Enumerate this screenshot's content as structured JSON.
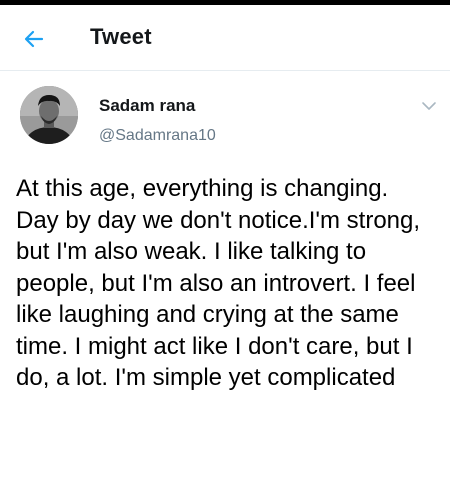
{
  "header": {
    "back_icon": "arrow-left-icon",
    "title": "Tweet",
    "accent_color": "#1da1f2"
  },
  "author": {
    "avatar": "avatar-photo",
    "display_name": "Sadam rana",
    "handle": "@Sadamrana10",
    "menu_icon": "chevron-down-icon"
  },
  "tweet": {
    "text": "At this age, everything is changing. Day by day we don't notice.I'm strong, but I'm also weak. I like talking to people, but I'm also an introvert. I feel like laughing and crying at the same time. I might act like I don't care, but I do, a lot. I'm simple yet complicated"
  }
}
